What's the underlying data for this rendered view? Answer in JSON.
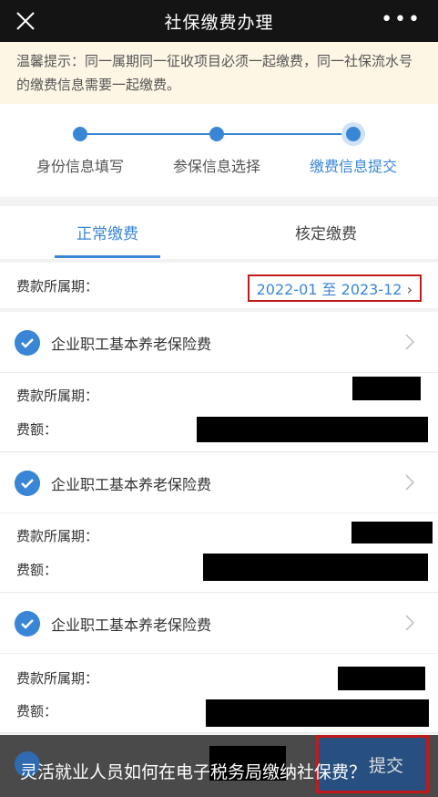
{
  "header": {
    "title": "社保缴费办理",
    "more": "•••"
  },
  "notice": {
    "text": "温馨提示：同一属期同一征收项目必须一起缴费，同一社保流水号的缴费信息需要一起缴费。"
  },
  "steps": [
    "身份信息填写",
    "参保信息选择",
    "缴费信息提交"
  ],
  "tabs": {
    "normal": "正常缴费",
    "assessed": "核定缴费"
  },
  "period": {
    "label": "费款所属期：",
    "value": "2022-01 至 2023-12"
  },
  "items": [
    {
      "name": "企业职工基本养老保险费",
      "period_label": "费款所属期：",
      "amount_label": "费额："
    },
    {
      "name": "企业职工基本养老保险费",
      "period_label": "费款所属期：",
      "amount_label": "费额："
    },
    {
      "name": "企业职工基本养老保险费",
      "period_label": "费款所属期：",
      "amount_label": "费额："
    }
  ],
  "bottom": {
    "caption": "灵活就业人员如何在电子税务局缴纳社保费？",
    "submit": "提交"
  },
  "colors": {
    "accent": "#3a86d6",
    "highlight_border": "#c21a1a",
    "notice_bg": "#fdf6e4"
  }
}
